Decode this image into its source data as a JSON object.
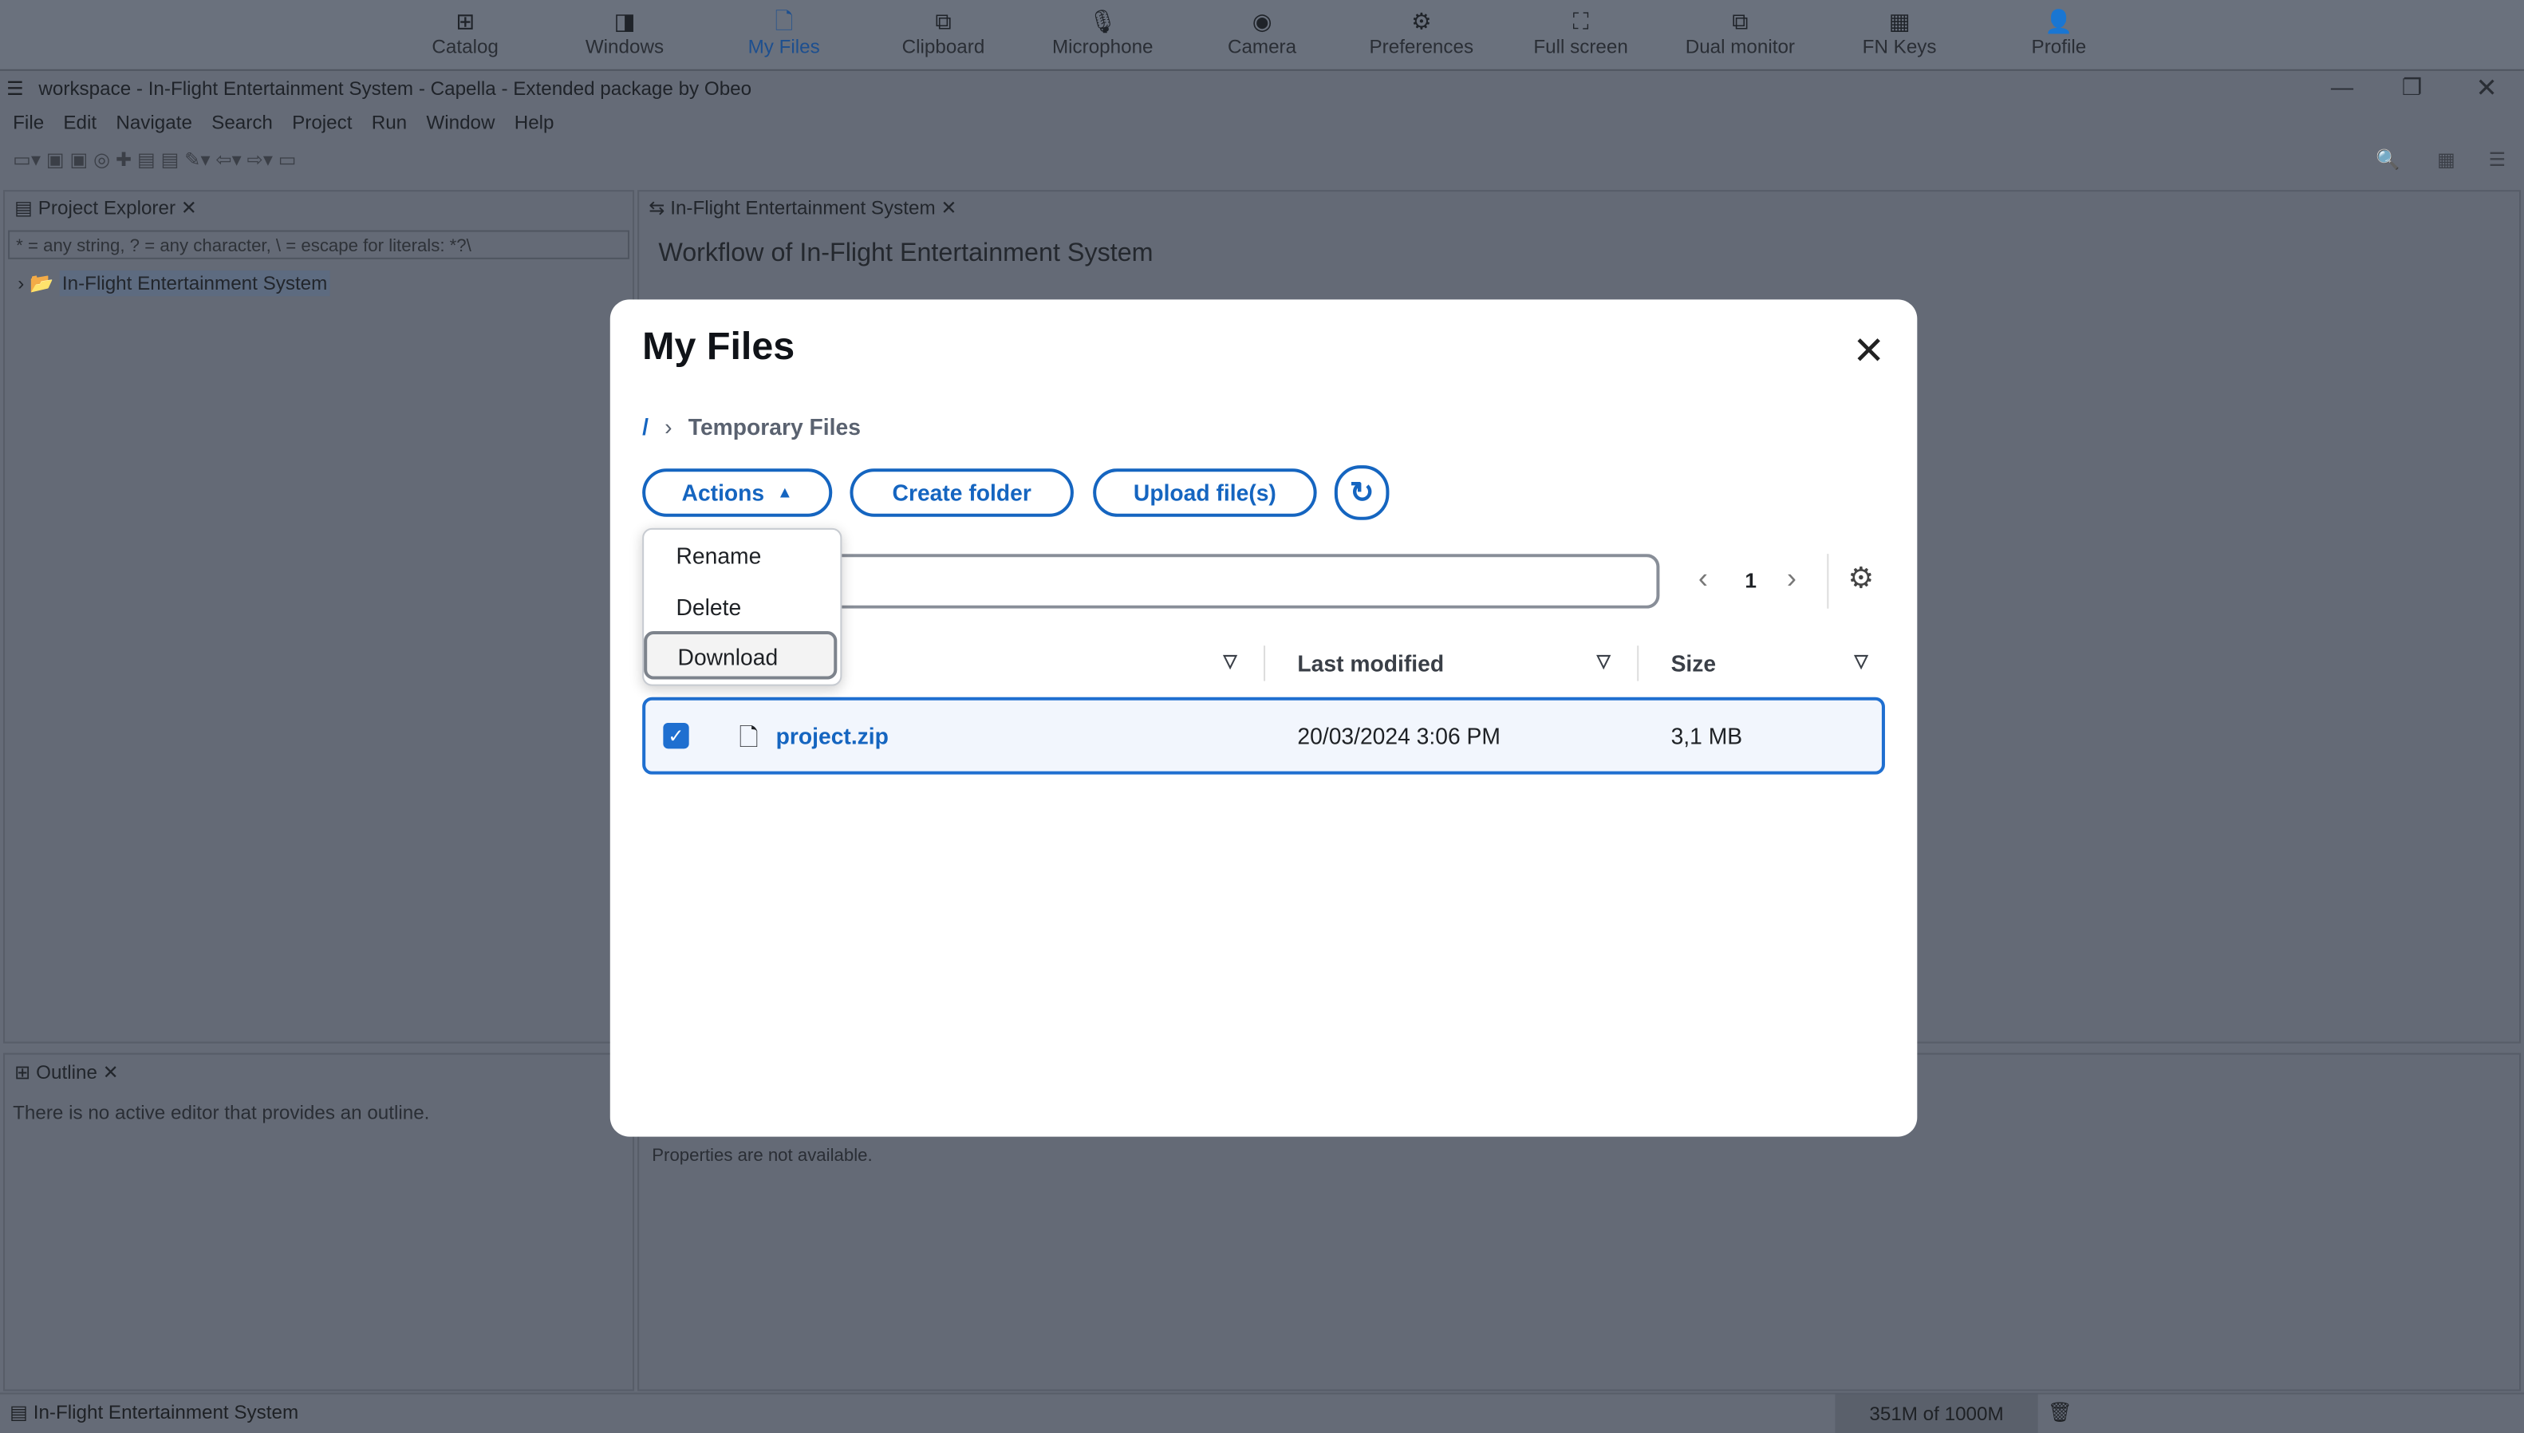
{
  "topbar": {
    "items": [
      {
        "label": "Catalog",
        "icon": "catalog-icon"
      },
      {
        "label": "Windows",
        "icon": "windows-icon"
      },
      {
        "label": "My Files",
        "icon": "file-icon",
        "active": true
      },
      {
        "label": "Clipboard",
        "icon": "clipboard-icon"
      },
      {
        "label": "Microphone",
        "icon": "microphone-icon"
      },
      {
        "label": "Camera",
        "icon": "camera-icon"
      },
      {
        "label": "Preferences",
        "icon": "gear-icon"
      },
      {
        "label": "Full screen",
        "icon": "fullscreen-icon"
      },
      {
        "label": "Dual monitor",
        "icon": "dual-monitor-icon"
      },
      {
        "label": "FN Keys",
        "icon": "keyboard-icon"
      },
      {
        "label": "Profile",
        "icon": "user-icon"
      }
    ]
  },
  "window": {
    "title": "workspace - In-Flight Entertainment System - Capella - Extended package by Obeo",
    "menu": [
      "File",
      "Edit",
      "Navigate",
      "Search",
      "Project",
      "Run",
      "Window",
      "Help"
    ]
  },
  "project_explorer": {
    "tab": "Project Explorer",
    "filter": "* = any string, ? = any character, \\ = escape for literals: *?\\",
    "tree_item": "In-Flight Entertainment System"
  },
  "editor": {
    "tab": "In-Flight Entertainment System",
    "heading": "Workflow of In-Flight Entertainment System"
  },
  "outline": {
    "tab": "Outline",
    "message": "There is no active editor that provides an outline."
  },
  "properties": {
    "message": "Properties are not available."
  },
  "status": {
    "left": "In-Flight Entertainment System",
    "memory": "351M of 1000M"
  },
  "modal": {
    "title": "My Files",
    "breadcrumb": {
      "root": "/",
      "current": "Temporary Files"
    },
    "buttons": {
      "actions": "Actions",
      "create_folder": "Create folder",
      "upload": "Upload file(s)"
    },
    "actions_menu": [
      "Rename",
      "Delete",
      "Download"
    ],
    "pagination": {
      "page": "1"
    },
    "columns": {
      "last_modified": "Last modified",
      "size": "Size"
    },
    "rows": [
      {
        "name": "project.zip",
        "modified": "20/03/2024 3:06 PM",
        "size": "3,1 MB",
        "selected": true
      }
    ]
  },
  "colors": {
    "accent": "#1565c0"
  }
}
